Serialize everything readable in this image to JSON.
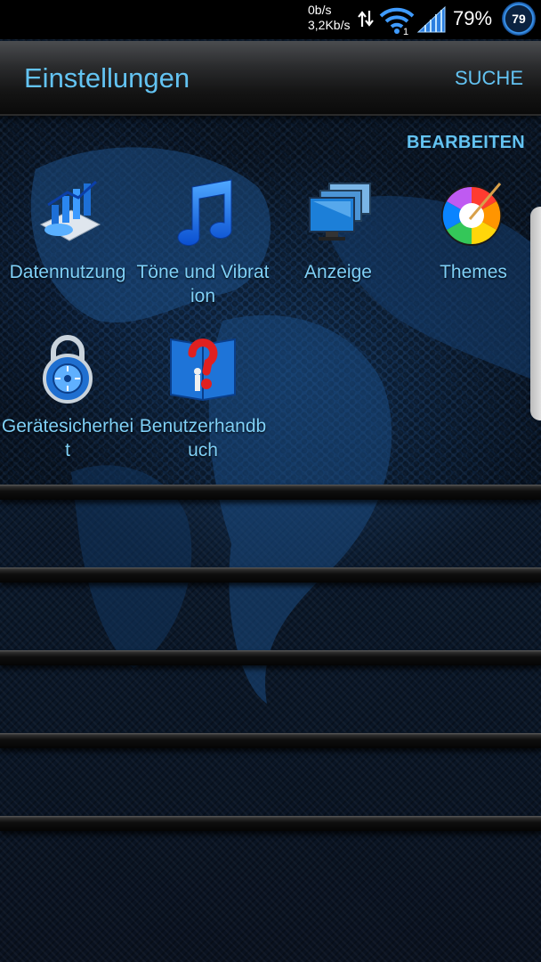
{
  "status_bar": {
    "upload_speed": "0b/s",
    "download_speed": "3,2Kb/s",
    "wifi_badge": "1",
    "battery_percent": "79%",
    "battery_level": "79"
  },
  "app_bar": {
    "title": "Einstellungen",
    "search_label": "SUCHE"
  },
  "edit_label": "BEARBEITEN",
  "tiles": [
    {
      "label": "Datennutzung",
      "icon": "data-usage-chart-icon"
    },
    {
      "label": "Töne und Vibration",
      "icon": "music-note-icon"
    },
    {
      "label": "Anzeige",
      "icon": "display-monitor-icon"
    },
    {
      "label": "Themes",
      "icon": "color-wheel-icon"
    },
    {
      "label": "Gerätesicherheit",
      "icon": "padlock-icon"
    },
    {
      "label": "Benutzerhandbuch",
      "icon": "help-book-icon"
    }
  ],
  "colors": {
    "accent": "#63c3f2",
    "label": "#7fd0f7",
    "appbar": "#1e1f21",
    "background": "#0b1a2e"
  }
}
